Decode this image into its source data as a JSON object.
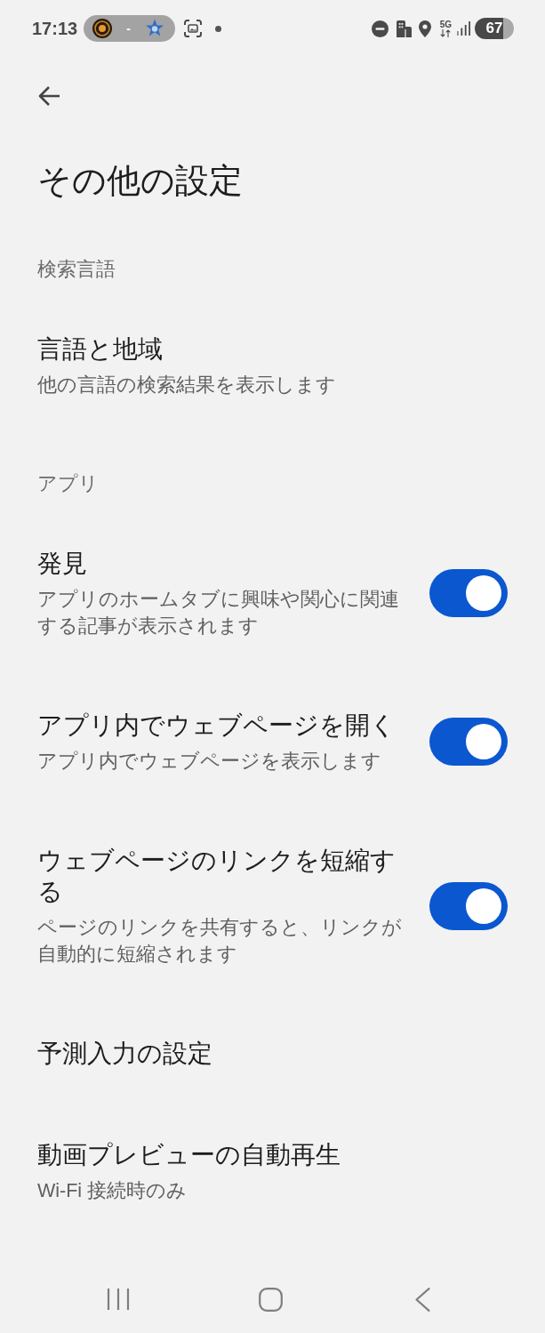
{
  "status_bar": {
    "time": "17:13",
    "match_separator": "-",
    "network_type": "5G",
    "battery": "67"
  },
  "title": "その他の設定",
  "sections": [
    {
      "label": "検索言語",
      "items": [
        {
          "kind": "link",
          "title": "言語と地域",
          "subtitle": "他の言語の検索結果を表示します"
        }
      ]
    },
    {
      "label": "アプリ",
      "items": [
        {
          "kind": "toggle",
          "title": "発見",
          "subtitle": "アプリのホームタブに興味や関心に関連する記事が表示されます",
          "on": true
        },
        {
          "kind": "toggle",
          "title": "アプリ内でウェブページを開く",
          "subtitle": "アプリ内でウェブページを表示します",
          "on": true
        },
        {
          "kind": "toggle",
          "title": "ウェブページのリンクを短縮する",
          "subtitle": "ページのリンクを共有すると、リンクが自動的に短縮されます",
          "on": true
        },
        {
          "kind": "link",
          "title": "予測入力の設定"
        },
        {
          "kind": "link",
          "title": "動画プレビューの自動再生",
          "subtitle": "Wi-Fi 接続時のみ"
        }
      ]
    }
  ]
}
